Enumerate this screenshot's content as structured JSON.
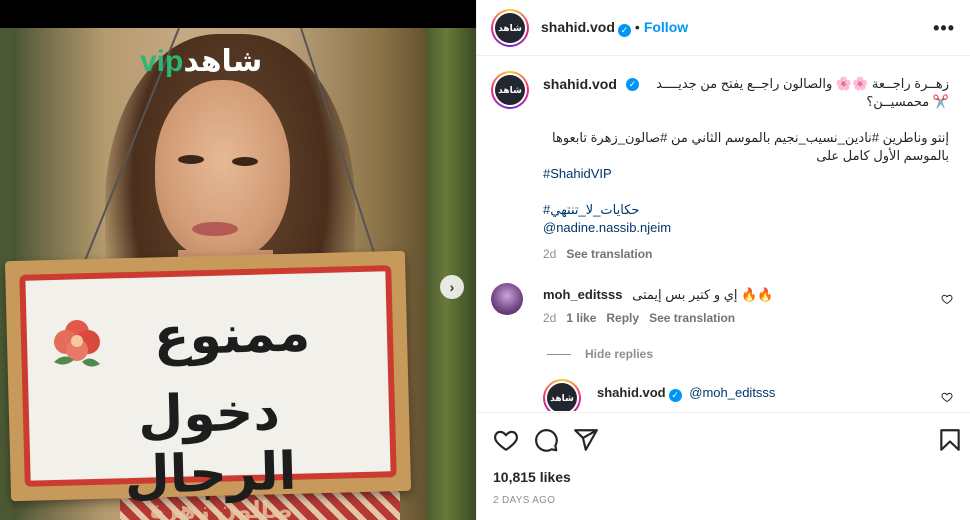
{
  "media": {
    "logo_vip": "vip",
    "logo_brand": "شاهد",
    "sign_line1": "ممنوع",
    "sign_line2": "دخول الرجال",
    "bottom_overlay_text": "صالون زهرة",
    "next_icon": "chevron-right-icon"
  },
  "header": {
    "avatar_text": "شاهد",
    "username": "shahid.vod",
    "verified_icon": "verified-badge-icon",
    "separator": "•",
    "follow_label": "Follow",
    "more_icon": "more-horizontal-icon"
  },
  "caption": {
    "username": "shahid.vod",
    "line1": "زهــرة راجــعة 🌸🌸 والصالون راجــع يفتح من جديــــد ✂️ محمسيــن؟",
    "line2": "إنتو وناطرين #نادين_نسيب_نجيم بالموسم الثاني من #صالون_زهرة تابعوها بالموسم الأول كامل على",
    "line3": "#ShahidVIP",
    "line4": "#حكايات_لا_تنتهي",
    "line5": "@nadine.nassib.njeim",
    "time": "2d",
    "see_translation": "See translation"
  },
  "comments": [
    {
      "username": "moh_editsss",
      "text": "إي و كتير بس إيمتى 🔥🔥",
      "time": "2d",
      "likes": "1 like",
      "reply": "Reply",
      "see_translation": "See translation"
    }
  ],
  "replies": {
    "hide_label": "Hide replies",
    "items": [
      {
        "username": "shahid.vod",
        "mention": "@moh_editsss"
      }
    ]
  },
  "actions": {
    "like_icon": "heart-icon",
    "comment_icon": "comment-icon",
    "share_icon": "share-icon",
    "save_icon": "bookmark-icon",
    "likes_count": "10,815 likes",
    "date": "2 DAYS AGO"
  },
  "colors": {
    "accent": "#0095f6",
    "hashtag": "#00376b",
    "secondary_text": "#8e8e8e",
    "sign_border": "#cc3b30",
    "vip_green": "#2bb673"
  }
}
